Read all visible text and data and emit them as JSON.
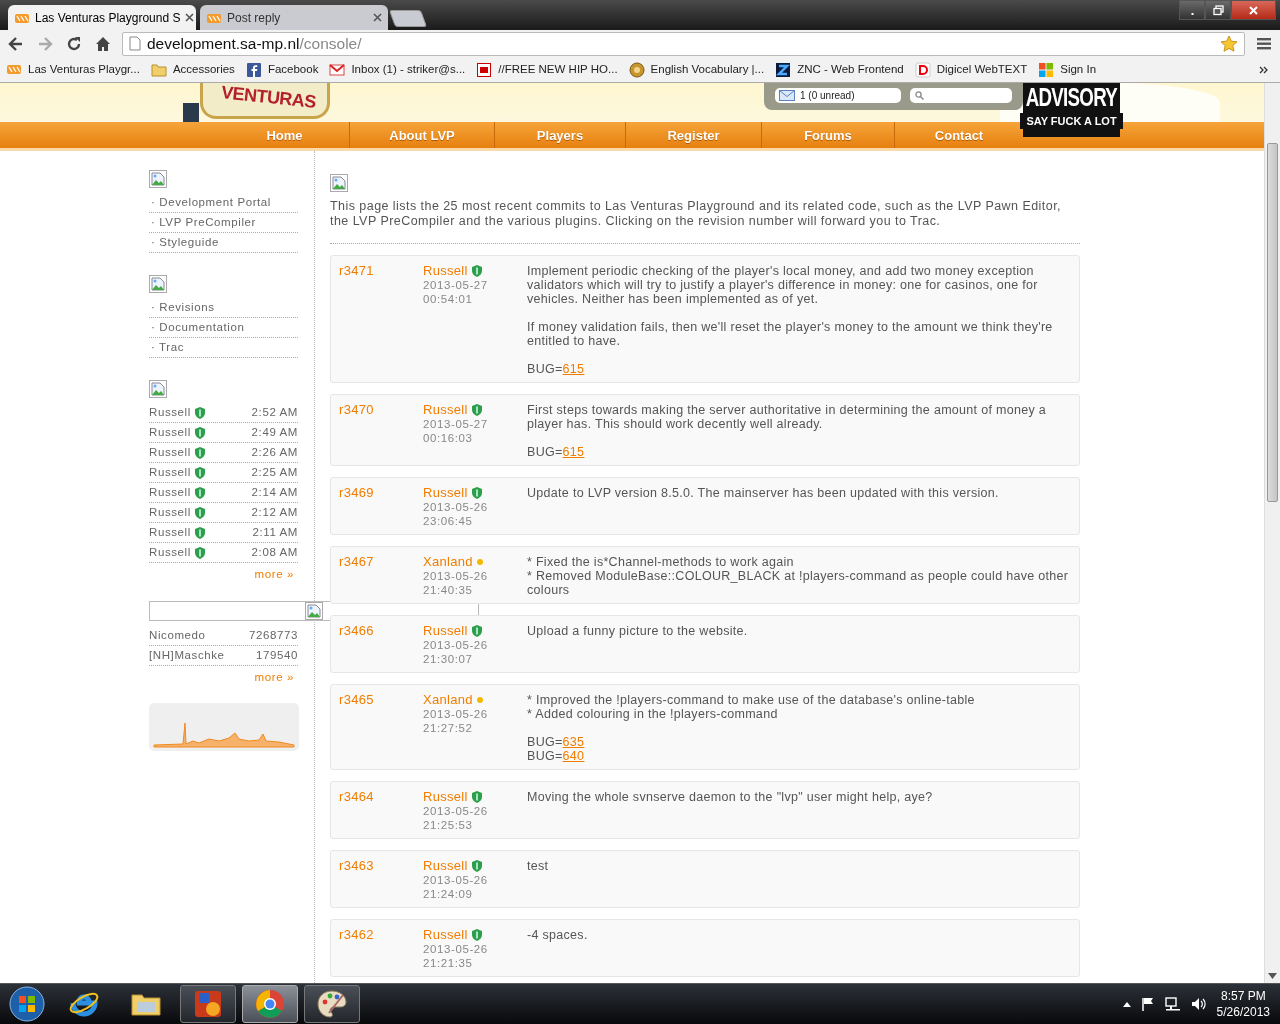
{
  "browser": {
    "tabs": [
      {
        "title": "Las Venturas Playground S",
        "selected": true
      },
      {
        "title": "Post reply",
        "selected": false
      }
    ],
    "forward": {
      "disabled": true
    },
    "url": {
      "host": "development.sa-mp.nl",
      "path": "/console/"
    },
    "bookmarks": [
      {
        "label": "Las Venturas Playgr...",
        "kind": "lvp"
      },
      {
        "label": "Accessories",
        "kind": "folder"
      },
      {
        "label": "Facebook",
        "kind": "facebook"
      },
      {
        "label": "Inbox (1) - striker@s...",
        "kind": "mail"
      },
      {
        "label": "//FREE NEW HIP HO...",
        "kind": "gh"
      },
      {
        "label": "English Vocabulary |...",
        "kind": "coin"
      },
      {
        "label": "ZNC - Web Frontend",
        "kind": "znc"
      },
      {
        "label": "Digicel WebTEXT",
        "kind": "digicel"
      },
      {
        "label": "Sign In",
        "kind": "windows"
      }
    ]
  },
  "header": {
    "sign_text": "VENTURAS",
    "mail": "1 (0 unread)",
    "advisory_top": "ADVISORY",
    "advisory_bottom": "SAY FUCK A LOT"
  },
  "nav": [
    "Home",
    "About LVP",
    "Players",
    "Register",
    "Forums",
    "Contact"
  ],
  "sidebar": {
    "links": [
      [
        "· Development Portal",
        "· LVP PreCompiler",
        "· Styleguide"
      ],
      [
        "· Revisions",
        "· Documentation",
        "· Trac"
      ]
    ],
    "recent_commits": [
      {
        "author": "Russell",
        "kind": "shield",
        "time": "2:52 AM"
      },
      {
        "author": "Russell",
        "kind": "shield",
        "time": "2:49 AM"
      },
      {
        "author": "Russell",
        "kind": "shield",
        "time": "2:26 AM"
      },
      {
        "author": "Russell",
        "kind": "shield",
        "time": "2:25 AM"
      },
      {
        "author": "Russell",
        "kind": "shield",
        "time": "2:14 AM"
      },
      {
        "author": "Russell",
        "kind": "shield",
        "time": "2:12 AM"
      },
      {
        "author": "Russell",
        "kind": "shield",
        "time": "2:11 AM"
      },
      {
        "author": "Russell",
        "kind": "shield",
        "time": "2:08 AM"
      }
    ],
    "commits_more": "more »",
    "players": [
      {
        "name": "Nicomedo",
        "score": "7268773"
      },
      {
        "name": "[NH]Maschke",
        "score": "179540"
      }
    ],
    "players_more": "more »"
  },
  "intro": "This page lists the 25 most recent commits to Las Venturas Playground and its related code, such as the LVP Pawn Editor, the LVP PreCompiler and the various plugins. Clicking on the revision number will forward you to Trac.",
  "commits": [
    {
      "revision": "r3471",
      "author": "Russell",
      "kind": "shield",
      "date": "2013-05-27",
      "time": "00:54:01",
      "paragraphs": [
        [
          "Implement periodic checking of the player's local money, and add two money exception validators which will try to justify a player's difference in money: one for casinos, one for vehicles. Neither has been implemented as of yet."
        ],
        [
          "If money validation fails, then we'll reset the player's money to the amount we think they're entitled to have."
        ]
      ],
      "bugs": [
        {
          "label": "BUG=",
          "number": "615"
        }
      ]
    },
    {
      "revision": "r3470",
      "author": "Russell",
      "kind": "shield",
      "date": "2013-05-27",
      "time": "00:16:03",
      "paragraphs": [
        [
          "First steps towards making the server authoritative in determining the amount of money a player has. This should work decently well already."
        ]
      ],
      "bugs": [
        {
          "label": "BUG=",
          "number": "615"
        }
      ]
    },
    {
      "revision": "r3469",
      "author": "Russell",
      "kind": "shield",
      "date": "2013-05-26",
      "time": "23:06:45",
      "paragraphs": [
        [
          "Update to LVP version 8.5.0. The mainserver has been updated with this version."
        ]
      ]
    },
    {
      "revision": "r3467",
      "author": "Xanland",
      "kind": "dot",
      "date": "2013-05-26",
      "time": "21:40:35",
      "paragraphs": [
        [
          "* Fixed the is*Channel-methods to work again",
          "* Removed ModuleBase::COLOUR_BLACK at !players-command as people could have other colours"
        ]
      ]
    },
    {
      "revision": "r3466",
      "author": "Russell",
      "kind": "shield",
      "date": "2013-05-26",
      "time": "21:30:07",
      "paragraphs": [
        [
          "Upload a funny picture to the website."
        ]
      ]
    },
    {
      "revision": "r3465",
      "author": "Xanland",
      "kind": "dot",
      "date": "2013-05-26",
      "time": "21:27:52",
      "paragraphs": [
        [
          "* Improved the !players-command to make use of the database's online-table",
          "* Added colouring in the !players-command"
        ]
      ],
      "bugs": [
        {
          "label": "BUG=",
          "number": "635"
        },
        {
          "label": "BUG=",
          "number": "640"
        }
      ]
    },
    {
      "revision": "r3464",
      "author": "Russell",
      "kind": "shield",
      "date": "2013-05-26",
      "time": "21:25:53",
      "paragraphs": [
        [
          "Moving the whole svnserve daemon to the \"lvp\" user might help, aye?"
        ]
      ]
    },
    {
      "revision": "r3463",
      "author": "Russell",
      "kind": "shield",
      "date": "2013-05-26",
      "time": "21:24:09",
      "paragraphs": [
        [
          "test"
        ]
      ]
    },
    {
      "revision": "r3462",
      "author": "Russell",
      "kind": "shield",
      "date": "2013-05-26",
      "time": "21:21:35",
      "paragraphs": [
        [
          "-4 spaces."
        ]
      ]
    }
  ],
  "taskbar": {
    "apps": [
      {
        "kind": "ie",
        "running": false,
        "selected": false
      },
      {
        "kind": "explorer",
        "running": false,
        "selected": false
      },
      {
        "kind": "app",
        "running": true,
        "selected": false
      },
      {
        "kind": "chrome",
        "running": true,
        "selected": true
      },
      {
        "kind": "paint",
        "running": true,
        "selected": false
      }
    ],
    "time": "8:57 PM",
    "date": "5/26/2013"
  }
}
